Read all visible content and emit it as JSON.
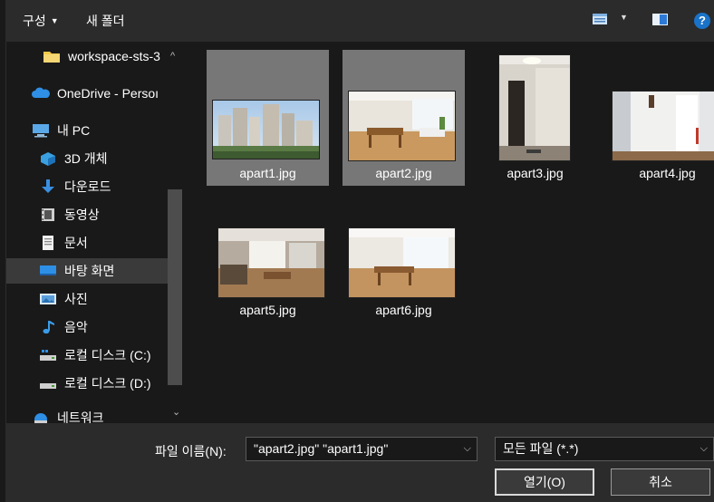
{
  "toolbar": {
    "organize_label": "구성",
    "new_folder_label": "새 폴더",
    "help_label": "?",
    "icons": [
      "view-mode-icon",
      "chevron-down-icon",
      "preview-pane-icon",
      "help-icon"
    ]
  },
  "nav": {
    "items": [
      {
        "label": "workspace-sts-3",
        "icon": "folder-icon"
      },
      {
        "label": "OneDrive - Persoı",
        "icon": "cloud-icon"
      },
      {
        "label": "내 PC",
        "icon": "computer-icon"
      },
      {
        "label": "3D 개체",
        "icon": "cube-icon"
      },
      {
        "label": "다운로드",
        "icon": "download-arrow-icon"
      },
      {
        "label": "동영상",
        "icon": "film-icon"
      },
      {
        "label": "문서",
        "icon": "document-icon"
      },
      {
        "label": "바탕 화면",
        "icon": "desktop-icon"
      },
      {
        "label": "사진",
        "icon": "picture-icon"
      },
      {
        "label": "음악",
        "icon": "music-note-icon"
      },
      {
        "label": "로컬 디스크 (C:)",
        "icon": "drive-icon"
      },
      {
        "label": "로컬 디스크 (D:)",
        "icon": "drive-icon"
      },
      {
        "label": "네트워크",
        "icon": "network-icon"
      }
    ],
    "selected": "바탕 화면"
  },
  "files": [
    {
      "name": "apart1.jpg",
      "selected": true
    },
    {
      "name": "apart2.jpg",
      "selected": true
    },
    {
      "name": "apart3.jpg",
      "selected": false
    },
    {
      "name": "apart4.jpg",
      "selected": false
    },
    {
      "name": "apart5.jpg",
      "selected": false
    },
    {
      "name": "apart6.jpg",
      "selected": false
    }
  ],
  "footer": {
    "file_name_label": "파일 이름(N):",
    "file_name_value": "\"apart2.jpg\" \"apart1.jpg\"",
    "file_type_value": "모든 파일 (*.*)",
    "open_label": "열기(O)",
    "cancel_label": "취소"
  },
  "colors": {
    "background": "#191919",
    "toolbar": "#2b2b2b",
    "selection": "#777777",
    "help_blue": "#1a73c8"
  }
}
